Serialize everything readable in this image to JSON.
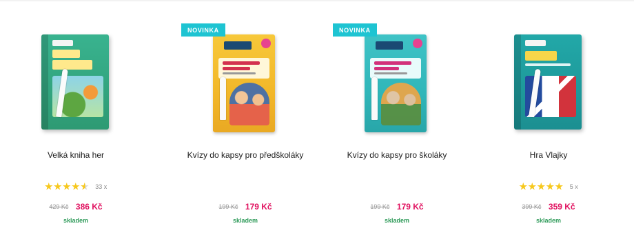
{
  "colors": {
    "badge": "#1ec4d2",
    "price": "#e0115f",
    "stock": "#2f9b5a",
    "star": "#f7c81c"
  },
  "products": [
    {
      "badge": "NOVINKA",
      "name": "Kvízy do kapsy pro předškoláky",
      "old_price": "199 Kč",
      "price": "179 Kč",
      "stock": "skladem",
      "image": "book-yellow"
    },
    {
      "badge": "NOVINKA",
      "name": "Kvízy do kapsy pro školáky",
      "old_price": "199 Kč",
      "price": "179 Kč",
      "stock": "skladem",
      "image": "book-teal"
    },
    {
      "name": "Hra Vlajky",
      "rating": 5,
      "reviews": "5 x",
      "old_price": "399 Kč",
      "price": "359 Kč",
      "stock": "skladem",
      "image": "box-flags"
    },
    {
      "name": "Velká kniha her",
      "rating": 4.5,
      "reviews": "33 x",
      "old_price": "429 Kč",
      "price": "386 Kč",
      "stock": "skladem",
      "image": "box-hry"
    }
  ]
}
